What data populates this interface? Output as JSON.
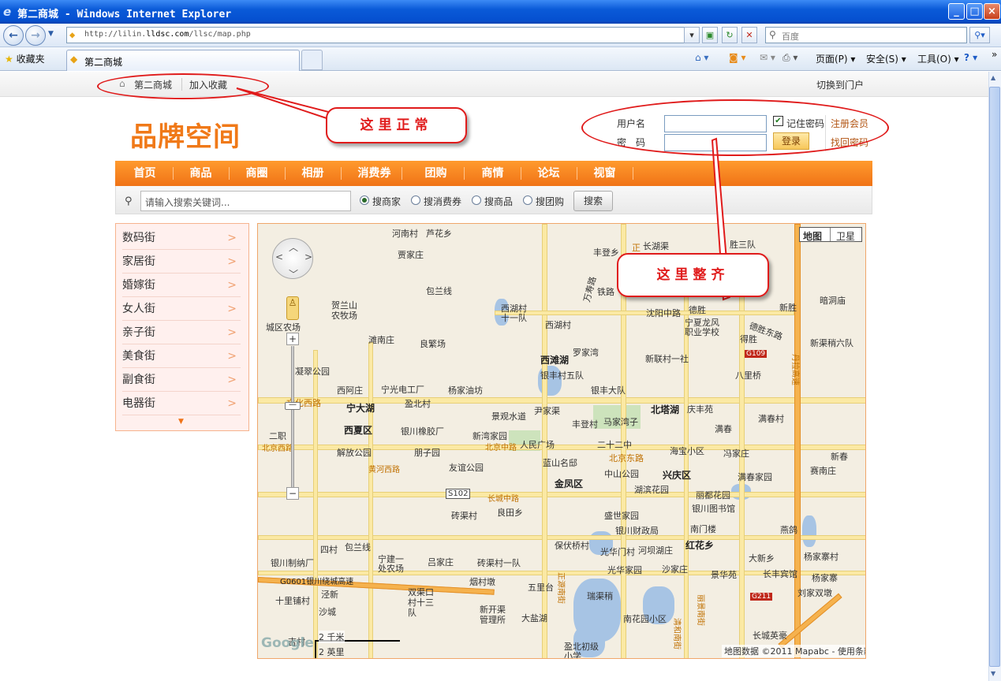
{
  "browser": {
    "window_title": "第二商城 - Windows Internet Explorer",
    "url_prefix": "http://lilin.",
    "url_host": "lldsc.com",
    "url_path": "/llsc/map.php",
    "search_placeholder": "百度",
    "favorites_label": "收藏夹",
    "tab_title": "第二商城",
    "tools": {
      "page": "页面(P)",
      "safety": "安全(S)",
      "tools": "工具(O)"
    }
  },
  "topbar": {
    "home": "第二商城",
    "bookmark": "加入收藏",
    "portal": "切换到门户"
  },
  "logo": "品牌空间",
  "login": {
    "username_label": "用户名",
    "password_label": "密　码",
    "remember_label": "记住密码",
    "remember_checked": true,
    "login_button": "登录",
    "register": "注册会员",
    "forgot": "找回密码"
  },
  "nav": [
    "首页",
    "商品",
    "商圈",
    "相册",
    "消费券",
    "团购",
    "商情",
    "论坛",
    "视窗"
  ],
  "search": {
    "placeholder": "请输入搜索关键词...",
    "options": [
      {
        "label": "搜商家",
        "selected": true
      },
      {
        "label": "搜消费券",
        "selected": false
      },
      {
        "label": "搜商品",
        "selected": false
      },
      {
        "label": "搜团购",
        "selected": false
      }
    ],
    "button": "搜索"
  },
  "categories": [
    "数码街",
    "家居街",
    "婚嫁街",
    "女人街",
    "亲子街",
    "美食街",
    "副食街",
    "电器街"
  ],
  "category_arrow": ">",
  "map": {
    "type_map": "地图",
    "type_satellite": "卫星",
    "scale_km": "2 千米",
    "scale_mi": "2 英里",
    "attribution": "地图数据 ©2011 Mapabc - 使用条款",
    "google": "Google",
    "labels": [
      "河南村",
      "芦花乡",
      "长湖渠",
      "胜三队",
      "丰登乡",
      "贾家庄",
      "万寿路",
      "包兰线",
      "铁路",
      "贺兰山农牧场",
      "西湖村十一队",
      "沈阳中路",
      "德胜",
      "新胜",
      "暗洞庙",
      "城区农场",
      "西湖村",
      "宁夏龙风职业学校",
      "德胜东路",
      "得胜",
      "滩南庄",
      "良繁场",
      "罗家湾",
      "新联村一社",
      "新渠稍六队",
      "凝翠公园",
      "西滩湖",
      "银丰村五队",
      "八里桥",
      "西阿庄",
      "宁光电工厂",
      "杨家油坊",
      "银丰大队",
      "盈北村",
      "文化西路",
      "宁大湖",
      "景观水道",
      "尹家渠",
      "北塔湖",
      "庆丰苑",
      "满春村",
      "二职",
      "西夏区",
      "银川橡胶厂",
      "丰登村",
      "马家湾子",
      "满春",
      "北京西路",
      "新湾家园",
      "人民广场",
      "二十二中",
      "海宝小区",
      "冯家庄",
      "解放公园",
      "朋子园",
      "北京中路",
      "北京东路",
      "新春",
      "友谊公园",
      "蓝山名邸",
      "中山公园",
      "兴庆区",
      "满春家园",
      "黄河西路",
      "金凤区",
      "湖滨花园",
      "丽都花园",
      "赛南庄",
      "S102",
      "长城中路",
      "银川图书馆",
      "砖渠村",
      "良田乡",
      "盛世家园",
      "南门楼",
      "燕鸽",
      "银川财政局",
      "四村",
      "包兰线",
      "保伏桥村",
      "光华门村",
      "河坝湖庄",
      "红花乡",
      "大新乡",
      "杨家寨村",
      "银川制纳厂",
      "宁建一处农场",
      "吕家庄",
      "砖渠村一队",
      "光华家园",
      "沙家庄",
      "景华苑",
      "长丰宾馆",
      "杨家寨",
      "烟村墩",
      "正源南街",
      "五里台",
      "瑞渠稍",
      "刘家双墩",
      "G0601银川绕城高速",
      "泾新",
      "双渠口村十三队",
      "丽景南街",
      "十里铺村",
      "沙城",
      "新开渠管理所",
      "大盐湖",
      "南花园小区",
      "清和南街",
      "长城英豪",
      "吉村",
      "盈北初级小学",
      "丹拉高速",
      "G109",
      "G211",
      "正"
    ]
  },
  "annotations": {
    "normal": "这里正常",
    "aligned": "这里整齐"
  },
  "colors": {
    "accent": "#f07316",
    "annotation": "#e01b1b",
    "link": "#b25412"
  }
}
